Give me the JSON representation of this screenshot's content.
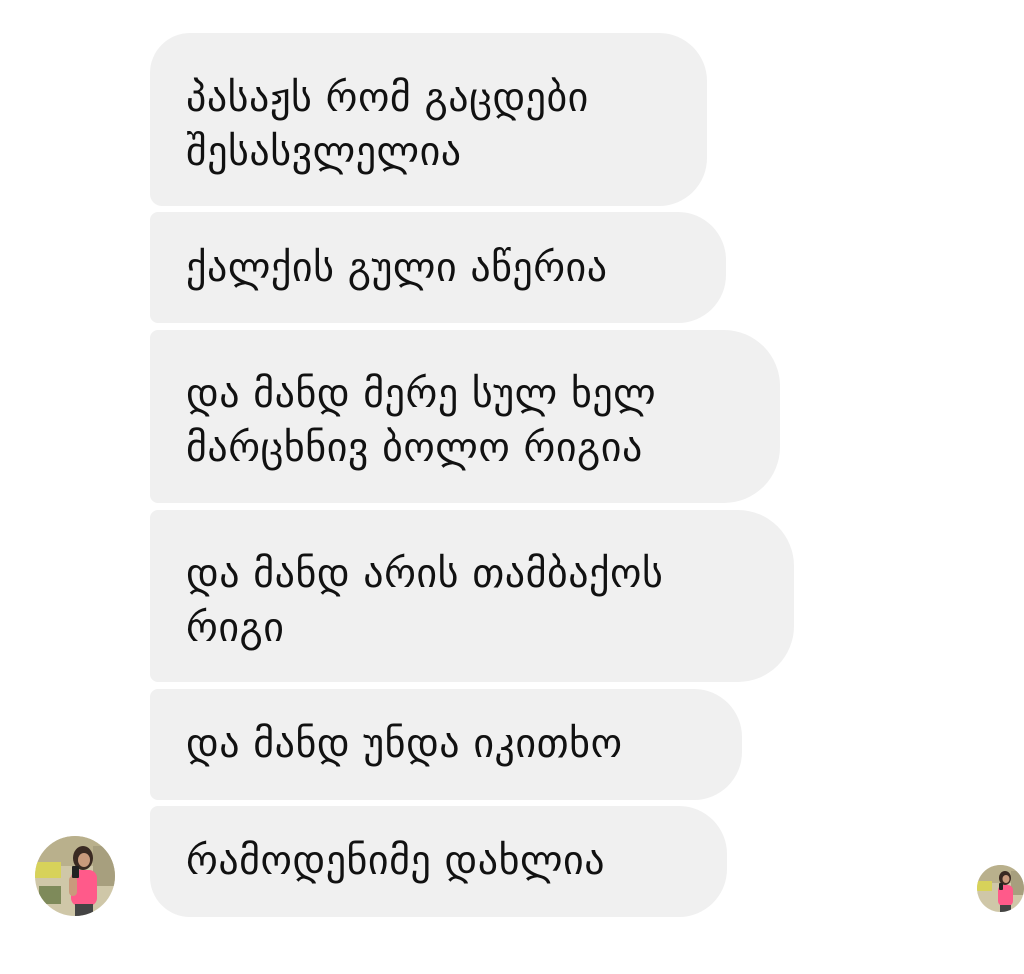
{
  "conversation": {
    "messages": [
      {
        "text": "პასაჟს რომ გაცდები\nშესასვლელია"
      },
      {
        "text": "ქალქის გული აწერია"
      },
      {
        "text": "და მანდ მერე სულ ხელ\nმარცხნივ ბოლო რიგია"
      },
      {
        "text": "და მანდ არის თამბაქოს\nრიგი"
      },
      {
        "text": "და მანდ უნდა იკითხო"
      },
      {
        "text": "რამოდენიმე დახლია"
      }
    ]
  },
  "colors": {
    "background": "#ffffff",
    "bubble": "#f0f0f0",
    "text": "#111111",
    "avatar_shirt": "#ff5a8a"
  },
  "icons": {
    "sender_avatar": "profile-photo-avatar",
    "read_receipt_avatar": "seen-avatar"
  }
}
